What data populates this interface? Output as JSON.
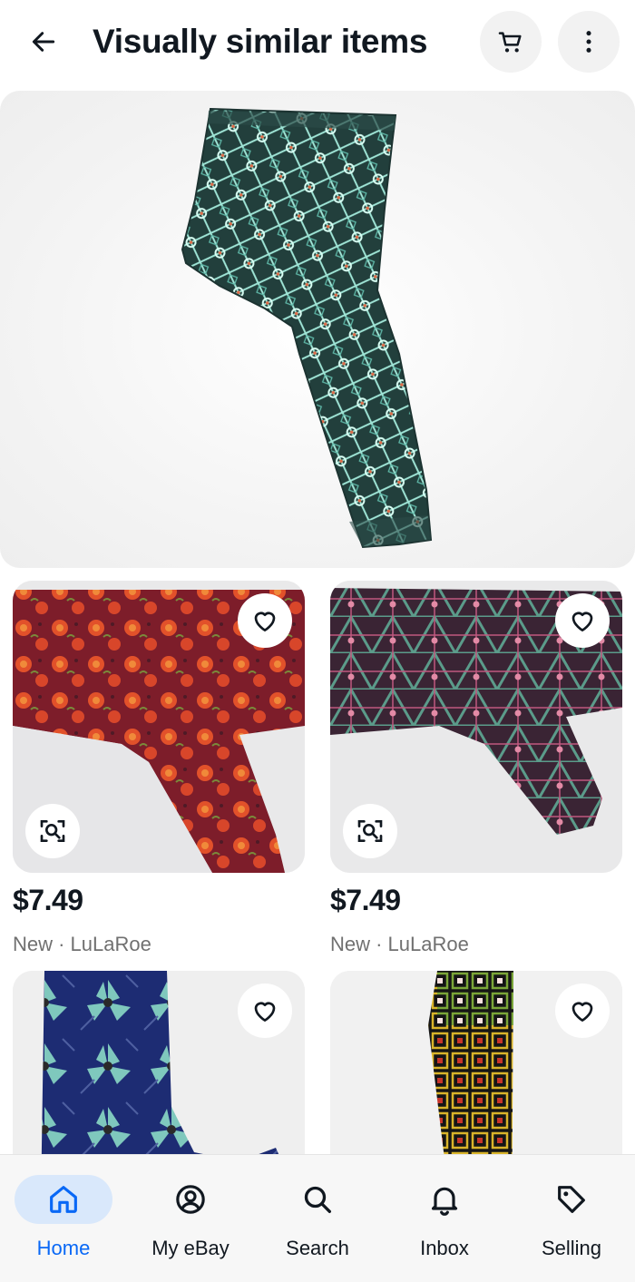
{
  "header": {
    "title": "Visually similar items"
  },
  "icons": {
    "back": "arrow-left-icon",
    "cart": "cart-icon",
    "more": "more-vertical-icon",
    "favorite": "heart-icon",
    "visual_search": "image-search-icon"
  },
  "hero": {
    "description_icon": "leggings-image"
  },
  "items": [
    {
      "price": "$7.49",
      "meta": "New · LuLaRoe",
      "colors": [
        "#8a1f2a",
        "#e34b22"
      ]
    },
    {
      "price": "$7.49",
      "meta": "New · LuLaRoe",
      "colors": [
        "#3a2434",
        "#4f8a7a"
      ]
    },
    {
      "price": "",
      "meta": "",
      "colors": [
        "#1d2c73",
        "#6ec0b8"
      ]
    },
    {
      "price": "",
      "meta": "",
      "colors": [
        "#111111",
        "#d9b42a"
      ]
    }
  ],
  "bottom_nav": [
    {
      "label": "Home",
      "icon": "home-icon",
      "active": true
    },
    {
      "label": "My eBay",
      "icon": "account-icon",
      "active": false
    },
    {
      "label": "Search",
      "icon": "search-icon",
      "active": false
    },
    {
      "label": "Inbox",
      "icon": "bell-icon",
      "active": false
    },
    {
      "label": "Selling",
      "icon": "tag-icon",
      "active": false
    }
  ],
  "colors": {
    "accent": "#0968f6",
    "accent_bg": "#d9e8fb",
    "text": "#111820",
    "muted": "#707070"
  }
}
